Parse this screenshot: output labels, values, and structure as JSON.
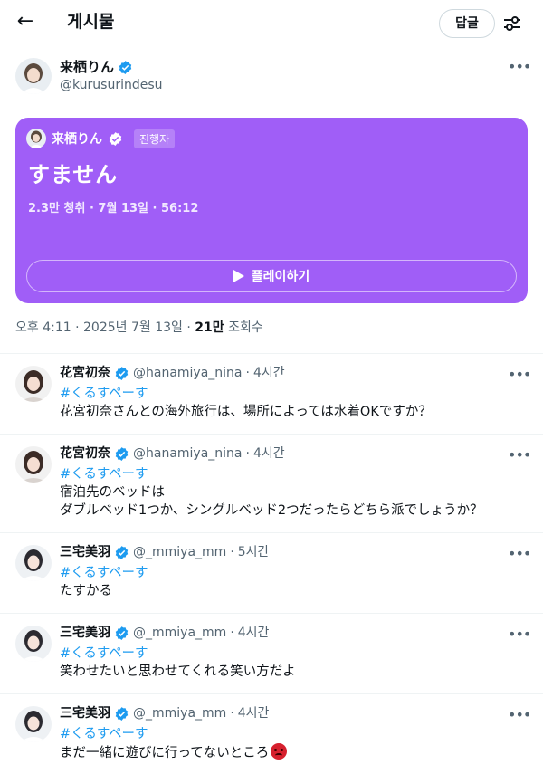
{
  "header": {
    "title": "게시물",
    "reply_button": "답글",
    "back_icon": "arrow-left-icon",
    "filter_icon": "sliders-icon"
  },
  "author": {
    "name": "来栖りん",
    "handle": "@kurusurindesu",
    "verified": true
  },
  "space": {
    "host_name": "来栖りん",
    "host_badge": "진행자",
    "title": "すません",
    "meta": "2.3만 청취 · 7월 13일 · 56:12",
    "play_label": "플레이하기",
    "color": "#a05ef7"
  },
  "post_meta": {
    "time": "오후 4:11 · 2025년 7월 13일 · ",
    "views_count": "21만",
    "views_label": " 조회수"
  },
  "replies": [
    {
      "name": "花宮初奈",
      "handle": "@hanamiya_nina",
      "time": "4시간",
      "tag": "#くるすペーす",
      "lines": [
        "花宮初奈さんとの海外旅行は、場所によっては水着OKですか？"
      ]
    },
    {
      "name": "花宮初奈",
      "handle": "@hanamiya_nina",
      "time": "4시간",
      "tag": "#くるすペーす",
      "lines": [
        "宿泊先のベッドは",
        "ダブルベッド1つか、シングルベッド2つだったらどちら派でしょうか？"
      ]
    },
    {
      "name": "三宅美羽",
      "handle": "@_mmiya_mm",
      "time": "5시간",
      "tag": "#くるすペーす",
      "lines": [
        "たすかる"
      ]
    },
    {
      "name": "三宅美羽",
      "handle": "@_mmiya_mm",
      "time": "4시간",
      "tag": "#くるすペーす",
      "lines": [
        "笑わせたいと思わせてくれる笑い方だよ"
      ]
    },
    {
      "name": "三宅美羽",
      "handle": "@_mmiya_mm",
      "time": "4시간",
      "tag": "#くるすペーす",
      "lines": [
        "まだ一緒に遊びに行ってないところ"
      ],
      "emoji": "angry-face-emoji"
    }
  ],
  "separator_dot": "·",
  "more_glyph": "•••"
}
